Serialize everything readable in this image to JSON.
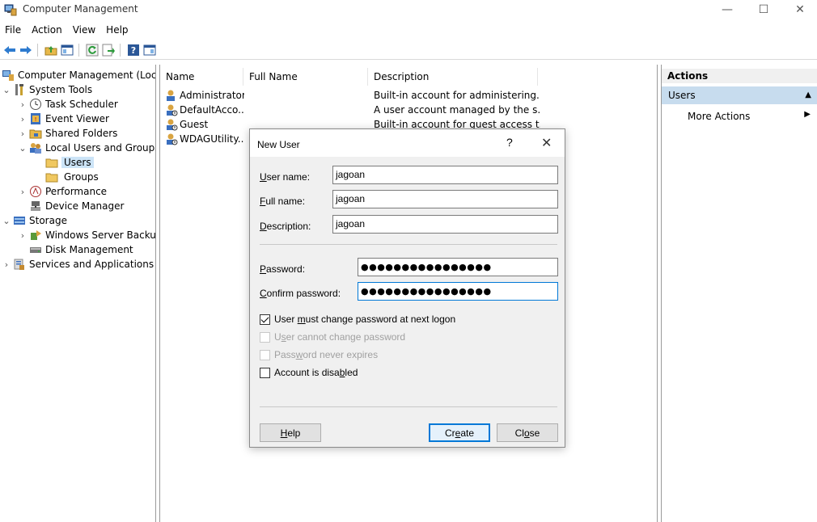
{
  "window": {
    "title": "Computer Management",
    "minimize": "—",
    "maximize": "☐",
    "close": "✕"
  },
  "menu": [
    "File",
    "Action",
    "View",
    "Help"
  ],
  "tree": {
    "root": "Computer Management (Local",
    "system_tools": "System Tools",
    "task_scheduler": "Task Scheduler",
    "event_viewer": "Event Viewer",
    "shared_folders": "Shared Folders",
    "local_users_groups": "Local Users and Groups",
    "users": "Users",
    "groups": "Groups",
    "performance": "Performance",
    "device_manager": "Device Manager",
    "storage": "Storage",
    "windows_server_backup": "Windows Server Backup",
    "disk_management": "Disk Management",
    "services_apps": "Services and Applications"
  },
  "list": {
    "columns": [
      "Name",
      "Full Name",
      "Description"
    ],
    "rows": [
      {
        "name": "Administrator",
        "full_name": "",
        "description": "Built-in account for administering..."
      },
      {
        "name": "DefaultAcco...",
        "full_name": "",
        "description": "A user account managed by the s..."
      },
      {
        "name": "Guest",
        "full_name": "",
        "description": "Built-in account for guest access t..."
      },
      {
        "name": "WDAGUtility...",
        "full_name": "",
        "description": ""
      }
    ]
  },
  "actions": {
    "header": "Actions",
    "section": "Users",
    "more": "More Actions"
  },
  "dialog": {
    "title": "New User",
    "help_glyph": "?",
    "close_glyph": "✕",
    "username_label_u": "U",
    "username_label_rest": "ser name:",
    "username_value": "jagoan",
    "fullname_label_f": "F",
    "fullname_label_rest": "ull name:",
    "fullname_value": "jagoan",
    "description_label_d": "D",
    "description_label_rest": "escription:",
    "description_value": "jagoan",
    "password_label_p": "P",
    "password_label_rest": "assword:",
    "password_value": "●●●●●●●●●●●●●●●●",
    "confirm_label_c": "C",
    "confirm_label_rest": "onfirm password:",
    "confirm_value": "●●●●●●●●●●●●●●●●",
    "cb_must_change_a": "User ",
    "cb_must_change_m": "m",
    "cb_must_change_b": "ust change password at next logon",
    "cb_must_change_checked": true,
    "cb_cannot_change_a": "U",
    "cb_cannot_change_s": "s",
    "cb_cannot_change_b": "er cannot change password",
    "cb_never_expires_a": "Pass",
    "cb_never_expires_w": "w",
    "cb_never_expires_b": "ord never expires",
    "cb_disabled_a": "Account is disa",
    "cb_disabled_b": "b",
    "cb_disabled_c": "led",
    "help_btn_h": "H",
    "help_btn_rest": "elp",
    "create_btn_a": "Cr",
    "create_btn_e": "e",
    "create_btn_b": "ate",
    "close_btn_a": "Cl",
    "close_btn_o": "o",
    "close_btn_b": "se"
  },
  "colors": {
    "accent": "#0078d7",
    "selection": "#cce4f7",
    "actions_section": "#c7dcee"
  }
}
